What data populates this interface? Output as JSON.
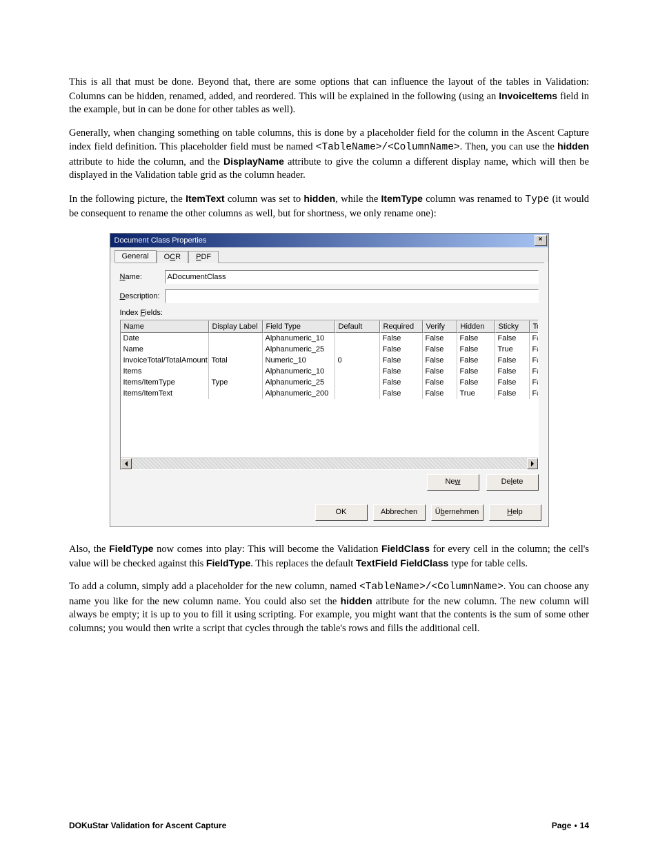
{
  "paragraphs": {
    "p1a": "This is all that must be done. Beyond that, there are some options that can influence the layout of the tables in Validation: Columns can be hidden, renamed, added, and reordered. This will be explained in the following (using an ",
    "p1b": "InvoiceItems",
    "p1c": " field in the example, but in can be done for other tables as well).",
    "p2a": "Generally, when changing something on table columns, this is done by a placeholder field for the column in the Ascent Capture index field definition. This placeholder field must be named ",
    "p2b": "<TableName>/<ColumnName>",
    "p2c": ". Then, you can use the ",
    "p2d": "hidden",
    "p2e": " attribute to hide the column, and the ",
    "p2f": "DisplayName",
    "p2g": " attribute to give the column a different display name, which will then be displayed in the Validation table grid as the column header.",
    "p3a": "In the following picture, the ",
    "p3b": "ItemText",
    "p3c": " column was set to ",
    "p3d": "hidden",
    "p3e": ", while the ",
    "p3f": "ItemType",
    "p3g": " column was renamed to ",
    "p3h": "Type",
    "p3i": " (it would be consequent to rename the other columns as well, but for shortness, we only rename one):",
    "p4a": "Also, the ",
    "p4b": "FieldType",
    "p4c": " now comes into play: This will become the Validation ",
    "p4d": "FieldClass",
    "p4e": " for every cell in the column; the cell's value will be checked against this ",
    "p4f": "FieldType",
    "p4g": ". This replaces the default ",
    "p4h": "TextField FieldClass",
    "p4i": " type for table cells.",
    "p5a": "To add a column, simply add a placeholder for the new column, named ",
    "p5b": "<TableName>/<ColumnName>",
    "p5c": ". You can choose any name you like for the new column name. You could also set the ",
    "p5d": "hidden",
    "p5e": " attribute for the new column. The new column will always be empty; it is up to you to fill it using scripting. For example, you might want that the contents is the sum of some other columns; you would then write a script that cycles through the table's rows and fills the additional cell."
  },
  "dialog": {
    "title": "Document Class Properties",
    "close": "×",
    "tabs": {
      "general": "General",
      "ocr_pre": "O",
      "ocr_ul": "C",
      "ocr_post": "R",
      "pdf_ul": "P",
      "pdf_post": "DF"
    },
    "name_label_ul": "N",
    "name_label_post": "ame:",
    "name_value": "ADocumentClass",
    "desc_label_ul": "D",
    "desc_label_post": "escription:",
    "fields_label_pre": "Index ",
    "fields_label_ul": "F",
    "fields_label_post": "ields:",
    "headers": {
      "c0": "Name",
      "c1": "Display Label",
      "c2": "Field Type",
      "c3": "Default",
      "c4": "Required",
      "c5": "Verify",
      "c6": "Hidden",
      "c7": "Sticky",
      "c8": "To"
    },
    "rows": [
      {
        "c0": "Date",
        "c1": "",
        "c2": "Alphanumeric_10",
        "c3": "",
        "c4": "False",
        "c5": "False",
        "c6": "False",
        "c7": "False",
        "c8": "Fa"
      },
      {
        "c0": "Name",
        "c1": "",
        "c2": "Alphanumeric_25",
        "c3": "",
        "c4": "False",
        "c5": "False",
        "c6": "False",
        "c7": "True",
        "c8": "Fa"
      },
      {
        "c0": "InvoiceTotal/TotalAmount",
        "c1": "Total",
        "c2": "Numeric_10",
        "c3": "0",
        "c4": "False",
        "c5": "False",
        "c6": "False",
        "c7": "False",
        "c8": "Fa"
      },
      {
        "c0": "Items",
        "c1": "",
        "c2": "Alphanumeric_10",
        "c3": "",
        "c4": "False",
        "c5": "False",
        "c6": "False",
        "c7": "False",
        "c8": "Fa"
      },
      {
        "c0": "Items/ItemType",
        "c1": "Type",
        "c2": "Alphanumeric_25",
        "c3": "",
        "c4": "False",
        "c5": "False",
        "c6": "False",
        "c7": "False",
        "c8": "Fa"
      },
      {
        "c0": "Items/ItemText",
        "c1": "",
        "c2": "Alphanumeric_200",
        "c3": "",
        "c4": "False",
        "c5": "False",
        "c6": "True",
        "c7": "False",
        "c8": "Fa"
      }
    ],
    "buttons": {
      "new_pre": "Ne",
      "new_ul": "w",
      "new_post": "",
      "del_pre": "De",
      "del_ul": "l",
      "del_post": "ete",
      "ok": "OK",
      "cancel": "Abbrechen",
      "apply_pre": "Ü",
      "apply_ul": "b",
      "apply_post": "ernehmen",
      "help_pre": "",
      "help_ul": "H",
      "help_post": "elp"
    }
  },
  "footer": {
    "left": "DOKuStar Validation for Ascent Capture",
    "right_a": "Page",
    "dot": "•",
    "right_b": "14"
  }
}
